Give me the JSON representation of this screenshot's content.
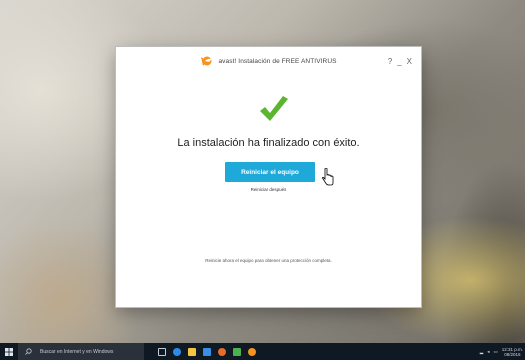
{
  "window": {
    "title": "avast! Instalación de FREE ANTIVIRUS",
    "help_label": "?",
    "minimize_label": "_",
    "close_label": "X",
    "headline": "La instalación ha finalizado con éxito.",
    "restart_button_label": "Reiniciar el equipo",
    "later_link_label": "Reiniciar después",
    "note": "Reinicie ahora el equipo para obtener una protección completa."
  },
  "taskbar": {
    "search_placeholder": "Buscar en Internet y en Windows",
    "tray_time": "12:31 p.m.",
    "tray_date": "08/2016"
  },
  "colors": {
    "accent_button": "#1ea9d9",
    "check_green": "#5cb531",
    "logo_orange": "#f7941d",
    "taskbar": "#0f1923"
  }
}
